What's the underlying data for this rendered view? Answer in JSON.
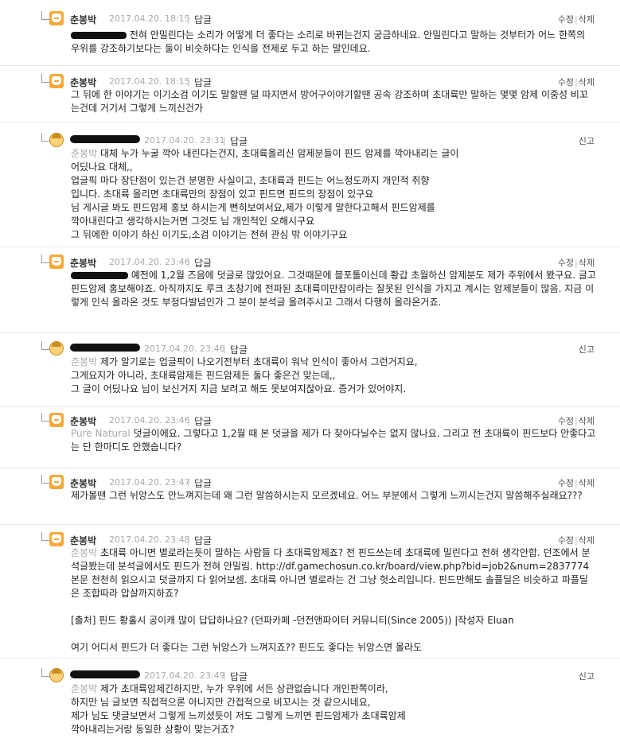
{
  "labels": {
    "reply": "답글",
    "edit": "수정",
    "delete": "삭제",
    "report": "신고",
    "bar": "|"
  },
  "comments": [
    {
      "author": "춘봉박",
      "date": "2017.04.20. 18:15",
      "text": "전혀 안밀린다는 소리가 어떻게 더 좋다는 소리로 바뀌는건지 궁금하네요. 안밀린다고 말하는 것부터가 어느 한쪽의 우위를 강조하기보다는 둘이 비슷하다는 인식을 전제로 두고 하는 말인데요."
    },
    {
      "author": "춘봉박",
      "date": "2017.04.20. 18:15",
      "text": "그 뒤에 한 이야기는 이기소검 이기도 말할땐 덜 따지면서 방어구이야기할땐 공속 강조하며 초대륙만 말하는 몇몇 암제 이중성 비꼬는건데 거기서 그렇게 느끼신건가"
    },
    {
      "author": "",
      "date": "2017.04.20. 23:31",
      "mention": "춘봉박",
      "text": "대체 누가 누굴 깍아 내린다는건지, 초대륙올리신 암제분들이 핀드 암제를 깍아내리는 글이\n어딨나요 대체,,\n업글픽 마다 장단점이 있는건 분명한 사실이고, 초대륙과 핀드는 어느정도까지 개인적 취향\n입니다. 초대륙 올리면 초대륙만의 장점이 있고 핀드면 핀드의 장점이 있구요\n님 게시글 봐도 핀드암제 홍보 하시는게 뻔히보여서요,제가 이렇게 말한다고해서 핀드암제를\n깍아내린다고 생각하시는거면 그것도 님 개인적인 오해시구요\n그 뒤에한 이야기 하신 이기도,소검 이야기는 전혀 관심 밖 이야기구요"
    },
    {
      "author": "춘봉박",
      "date": "2017.04.20. 23:46",
      "text": "예전에 1,2월 즈음에 덧글로 많았어요. 그것때문에 블포톨이신데 황갑 초월하신 암제분도 제가 주위에서 봤구요. 글고 핀드암제 홍보해야죠. 아직까지도 루크 초창기에 전파된 초대륙미만잡이라는 잘못된 인식을 가지고 계시는 암제분들이 많음. 지금 이렇게 인식 올라온 것도 부정다발넘인가 그 분이 분석글 올려주시고 그래서 다행히 올라온거죠."
    },
    {
      "author": "",
      "date": "2017.04.20. 23:46",
      "mention": "춘봉박",
      "text": "제가 알기로는 업글픽이 나오기전부터 초대륙이 워낙 인식이 좋아서 그런거지요,\n그게요지가 아니라, 초대륙암제든 핀드암제든 둘다 좋은건 맞는데,,\n그 글이 어딨나요 님이 보신거지 지금 보려고 해도 못보여지잖아요. 증거가 있어야지."
    },
    {
      "author": "춘봉박",
      "date": "2017.04.20. 23:46",
      "mention": "Pure Natural",
      "text": "덧글이에요. 그렇다고 1,2월 때 본 덧글을 제가 다 찾아다닐수는 없지 않나요. 그리고 전 초대륙이 핀드보다 안좋다고는 단 한마디도 안했습니다?"
    },
    {
      "author": "춘봉박",
      "date": "2017.04.20. 23:47",
      "text": "제가볼땐 그런 뉘앙스도 안느껴지는데 왜 그런 말씀하시는지 모르겠네요. 어느 부분에서 그렇게 느끼시는건지 말씀해주실래요???"
    },
    {
      "author": "춘봉박",
      "date": "2017.04.20. 23:48",
      "mention": "춘봉박",
      "text": "초대륙 아니면 별로라는듯이 말하는 사람들 다 초대륙암제죠? 전 핀드쓰는데 초대륙에 밀린다고 전혀 생각안합. 던조에서 분석글봤는데 분석글에서도 핀드가 전혀 안밀림. http://df.gamechosun.co.kr/board/view.php?bid=job2&num=2837774 본문 천천히 읽으시고 덧글까지 다 읽어보셈. 초대륙 아니면 별로라는 건 그냥 헛소리입니다. 핀드만해도 솔플딜은 비슷하고 파플딜은 조합따라 압살까지하죠?\n\n[출처] 핀드 황홀시 공이캐 많이 답답하나요? (던파카페 -던전앤파이터 커뮤니티(Since 2005)) |작성자 Eluan\n\n여기 어디서 핀드가 더 좋다는 그런 뉘앙스가 느껴지죠?? 핀드도 좋다는 뉘앙스면 몰라도"
    },
    {
      "author": "",
      "date": "2017.04.20. 23:49",
      "mention": "춘봉박",
      "text": "제가 초대륙암제긴하지만, 누가 우위에 서든 상관없습니다 개인판쪽이라,\n하지만 님 글보면 직접적으론 아니지만 간접적으로 비꼬시는 것 같으시네요,\n제가 님도 댓글보면서 그렇게 느끼셨듯이 저도 그렇게 느끼면 핀드암제가 초대륙암제\n깍아내리는거랑 동일한 상황이 맞는거죠?"
    }
  ]
}
